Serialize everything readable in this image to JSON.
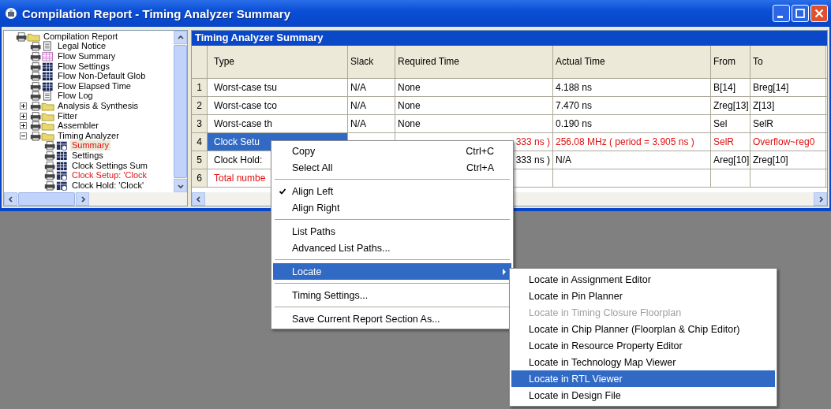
{
  "window": {
    "title": "Compilation Report - Timing Analyzer Summary"
  },
  "tree": [
    {
      "label": "Compilation Report",
      "kind": "folder",
      "selected": false,
      "warning": false,
      "children": [
        {
          "label": "Legal Notice",
          "kind": "document",
          "selected": false,
          "warning": false
        },
        {
          "label": "Flow Summary",
          "kind": "summary",
          "selected": false,
          "warning": false
        },
        {
          "label": "Flow Settings",
          "kind": "table",
          "selected": false,
          "warning": false
        },
        {
          "label": "Flow Non-Default Glob",
          "kind": "table",
          "selected": false,
          "warning": false
        },
        {
          "label": "Flow Elapsed Time",
          "kind": "table",
          "selected": false,
          "warning": false
        },
        {
          "label": "Flow Log",
          "kind": "document",
          "selected": false,
          "warning": false
        },
        {
          "label": "Analysis & Synthesis",
          "kind": "folder",
          "expanded": false,
          "selected": false,
          "warning": false
        },
        {
          "label": "Fitter",
          "kind": "folder",
          "expanded": false,
          "selected": false,
          "warning": false
        },
        {
          "label": "Assembler",
          "kind": "folder",
          "expanded": false,
          "selected": false,
          "warning": false
        },
        {
          "label": "Timing Analyzer",
          "kind": "folder",
          "expanded": true,
          "selected": false,
          "warning": false,
          "children": [
            {
              "label": "Summary",
              "kind": "timing",
              "selected": true,
              "warning": true
            },
            {
              "label": "Settings",
              "kind": "table",
              "selected": false,
              "warning": false
            },
            {
              "label": "Clock Settings Sum",
              "kind": "table",
              "selected": false,
              "warning": false
            },
            {
              "label": "Clock Setup: 'Clock",
              "kind": "timing",
              "selected": false,
              "warning": true
            },
            {
              "label": "Clock Hold: 'Clock'",
              "kind": "timing",
              "selected": false,
              "warning": false
            }
          ]
        }
      ]
    }
  ],
  "table": {
    "title": "Timing Analyzer Summary",
    "columns": [
      "Type",
      "Slack",
      "Required Time",
      "Actual Time",
      "From",
      "To"
    ],
    "rows": [
      {
        "number": "1",
        "selected": false,
        "warning": false,
        "type": "Worst-case tsu",
        "slack": "N/A",
        "required_time": "None",
        "actual_time": "4.188 ns",
        "from": "B[14]",
        "to": "Breg[14]"
      },
      {
        "number": "2",
        "selected": false,
        "warning": false,
        "type": "Worst-case tco",
        "slack": "N/A",
        "required_time": "None",
        "actual_time": "7.470 ns",
        "from": "Zreg[13]",
        "to": "Z[13]"
      },
      {
        "number": "3",
        "selected": false,
        "warning": false,
        "type": "Worst-case th",
        "slack": "N/A",
        "required_time": "None",
        "actual_time": "0.190 ns",
        "from": "Sel",
        "to": "SelR"
      },
      {
        "number": "4",
        "selected": true,
        "warning": true,
        "type": "Clock Setu",
        "required_time": "333 ns )",
        "actual_time": "256.08 MHz ( period = 3.905 ns )",
        "from": "SelR",
        "to": "Overflow~reg0"
      },
      {
        "number": "5",
        "selected": false,
        "warning": false,
        "type": "Clock Hold:",
        "required_time": "333 ns )",
        "actual_time": "N/A",
        "from": "Areg[10]",
        "to": "Zreg[10]"
      },
      {
        "number": "6",
        "selected": false,
        "warning": true,
        "type": "Total numbe"
      }
    ]
  },
  "context_menu": {
    "groups": [
      [
        {
          "label": "Copy",
          "shortcut": "Ctrl+C",
          "checked": false,
          "selected": false
        },
        {
          "label": "Select All",
          "shortcut": "Ctrl+A",
          "checked": false,
          "selected": false
        }
      ],
      [
        {
          "label": "Align Left",
          "checked": true,
          "selected": false
        },
        {
          "label": "Align Right",
          "checked": false,
          "selected": false
        }
      ],
      [
        {
          "label": "List Paths",
          "checked": false,
          "selected": false
        },
        {
          "label": "Advanced List Paths...",
          "checked": false,
          "selected": false
        }
      ],
      [
        {
          "label": "Locate",
          "checked": false,
          "selected": true,
          "submenu": true
        }
      ],
      [
        {
          "label": "Timing Settings...",
          "checked": false,
          "selected": false
        }
      ],
      [
        {
          "label": "Save Current Report Section As...",
          "checked": false,
          "selected": false
        }
      ]
    ]
  },
  "submenu": {
    "items": [
      {
        "label": "Locate in Assignment Editor",
        "disabled": false,
        "selected": false
      },
      {
        "label": "Locate in Pin Planner",
        "disabled": false,
        "selected": false
      },
      {
        "label": "Locate in Timing Closure Floorplan",
        "disabled": true,
        "selected": false
      },
      {
        "label": "Locate in Chip Planner (Floorplan & Chip Editor)",
        "disabled": false,
        "selected": false
      },
      {
        "label": "Locate in Resource Property Editor",
        "disabled": false,
        "selected": false
      },
      {
        "label": "Locate in Technology Map Viewer",
        "disabled": false,
        "selected": false
      },
      {
        "label": "Locate in RTL Viewer",
        "disabled": false,
        "selected": true
      },
      {
        "label": "Locate in Design File",
        "disabled": false,
        "selected": false
      }
    ]
  }
}
